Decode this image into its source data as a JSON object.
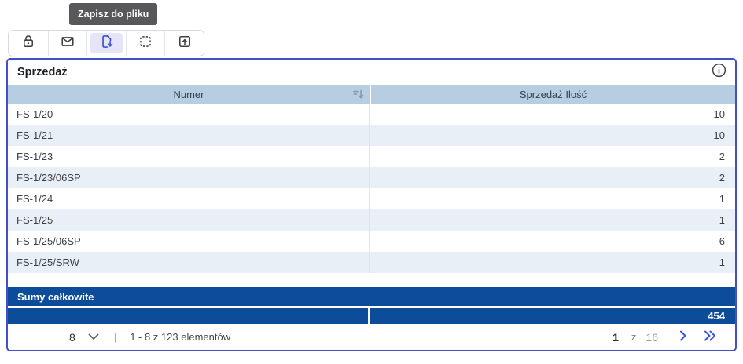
{
  "tooltip": {
    "label": "Zapisz do pliku"
  },
  "toolbar": {
    "buttons": [
      {
        "name": "lock",
        "selected": false
      },
      {
        "name": "email",
        "selected": false
      },
      {
        "name": "save-to-file",
        "selected": true
      },
      {
        "name": "selection",
        "selected": false
      },
      {
        "name": "export",
        "selected": false
      }
    ]
  },
  "panel": {
    "title": "Sprzedaż",
    "columns": [
      {
        "label": "Numer",
        "sorted": "asc"
      },
      {
        "label": "Sprzedaż Ilość"
      }
    ],
    "rows": [
      {
        "numer": "FS-1/20",
        "ilosc": "10"
      },
      {
        "numer": "FS-1/21",
        "ilosc": "10"
      },
      {
        "numer": "FS-1/23",
        "ilosc": "2"
      },
      {
        "numer": "FS-1/23/06SP",
        "ilosc": "2"
      },
      {
        "numer": "FS-1/24",
        "ilosc": "1"
      },
      {
        "numer": "FS-1/25",
        "ilosc": "1"
      },
      {
        "numer": "FS-1/25/06SP",
        "ilosc": "6"
      },
      {
        "numer": "FS-1/25/SRW",
        "ilosc": "1"
      }
    ],
    "totals": {
      "label": "Sumy całkowite",
      "value": "454"
    },
    "pagination": {
      "page_size": "8",
      "separator": "|",
      "range_text": "1 - 8 z 123 elementów",
      "current_page": "1",
      "of_label": "z",
      "total_pages": "16"
    }
  },
  "colors": {
    "dark_blue": "#0d4c99",
    "header_blue": "#b6cde2",
    "stripe_blue": "#e9eff7",
    "panel_border": "#4150c8",
    "icon_blue": "#3a4fd0",
    "selected_tool_bg": "#e5e4f9",
    "tooltip_bg": "#58585b",
    "chevron_blue": "#3a55d9"
  }
}
